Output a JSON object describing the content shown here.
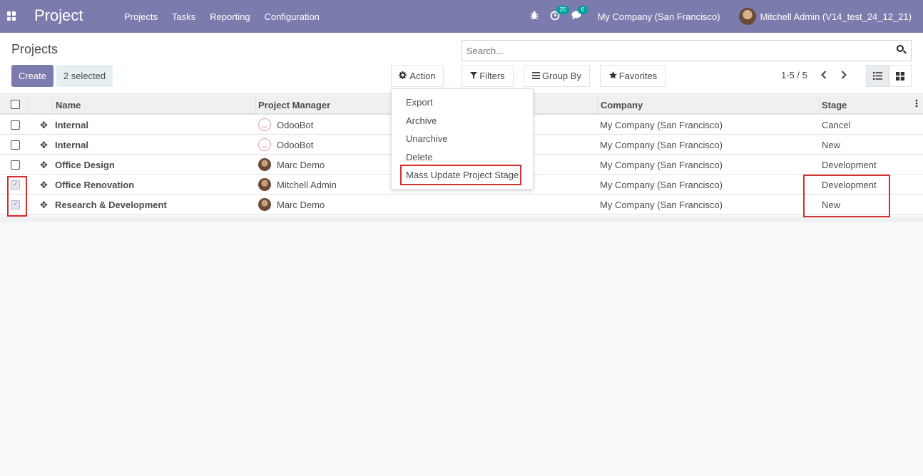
{
  "navbar": {
    "brand": "Project",
    "menu": [
      "Projects",
      "Tasks",
      "Reporting",
      "Configuration"
    ],
    "activity_count": "25",
    "message_count": "6",
    "company": "My Company (San Francisco)",
    "user": "Mitchell Admin (V14_test_24_12_21)"
  },
  "control_panel": {
    "breadcrumb": "Projects",
    "create_label": "Create",
    "selected_label": "2 selected",
    "action_label": "Action",
    "search_placeholder": "Search...",
    "filters_label": "Filters",
    "groupby_label": "Group By",
    "favorites_label": "Favorites",
    "pager": "1-5 / 5"
  },
  "action_menu": {
    "items": [
      "Export",
      "Archive",
      "Unarchive",
      "Delete",
      "Mass Update Project Stage"
    ]
  },
  "table": {
    "columns": [
      "Name",
      "Project Manager",
      "Company",
      "Stage"
    ],
    "rows": [
      {
        "name": "Internal",
        "manager": "OdooBot",
        "company": "My Company (San Francisco)",
        "stage": "Cancel",
        "checked": false
      },
      {
        "name": "Internal",
        "manager": "OdooBot",
        "company": "My Company (San Francisco)",
        "stage": "New",
        "checked": false
      },
      {
        "name": "Office Design",
        "manager": "Marc Demo",
        "company": "My Company (San Francisco)",
        "stage": "Development",
        "checked": false
      },
      {
        "name": "Office Renovation",
        "manager": "Mitchell Admin",
        "company": "My Company (San Francisco)",
        "stage": "Development",
        "checked": true
      },
      {
        "name": "Research & Development",
        "manager": "Marc Demo",
        "company": "My Company (San Francisco)",
        "stage": "New",
        "checked": true
      }
    ]
  },
  "colors": {
    "navbar": "#7c7bad",
    "highlight": "#d32f2f",
    "badge": "#00a09d"
  }
}
